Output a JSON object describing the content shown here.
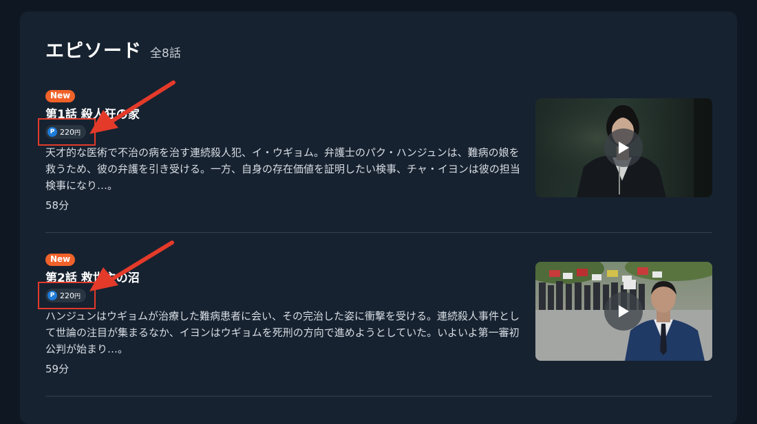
{
  "section": {
    "title": "エピソード",
    "count": "全8話"
  },
  "episodes": [
    {
      "badge": "New",
      "title": "第1話 殺人狂の家",
      "price_icon": "P",
      "price": "220",
      "price_unit": "円",
      "description": "天才的な医術で不治の病を治す連続殺人犯、イ・ウギョム。弁護士のパク・ハンジュンは、難病の娘を救うため、彼の弁護を引き受ける。一方、自身の存在価値を証明したい検事、チャ・イヨンは彼の担当検事になり…。",
      "duration": "58分",
      "thumbnail": "thumbnail-woman-in-dark-suit"
    },
    {
      "badge": "New",
      "title": "第2話 救世主の沼",
      "price_icon": "P",
      "price": "220",
      "price_unit": "円",
      "description": "ハンジュンはウギョムが治療した難病患者に会い、その完治した姿に衝撃を受ける。連続殺人事件として世論の注目が集まるなか、イヨンはウギョムを死刑の方向で進めようとしていた。いよいよ第一審初公判が始まり…。",
      "duration": "59分",
      "thumbnail": "thumbnail-man-with-protest-crowd"
    }
  ],
  "colors": {
    "background": "#0f1822",
    "panel": "#172230",
    "new_badge": "#f0622a",
    "annotation": "#e43a2a",
    "point_icon": "#1d7bd8"
  },
  "icons": {
    "play": "play-icon",
    "point": "point-coin-icon"
  }
}
